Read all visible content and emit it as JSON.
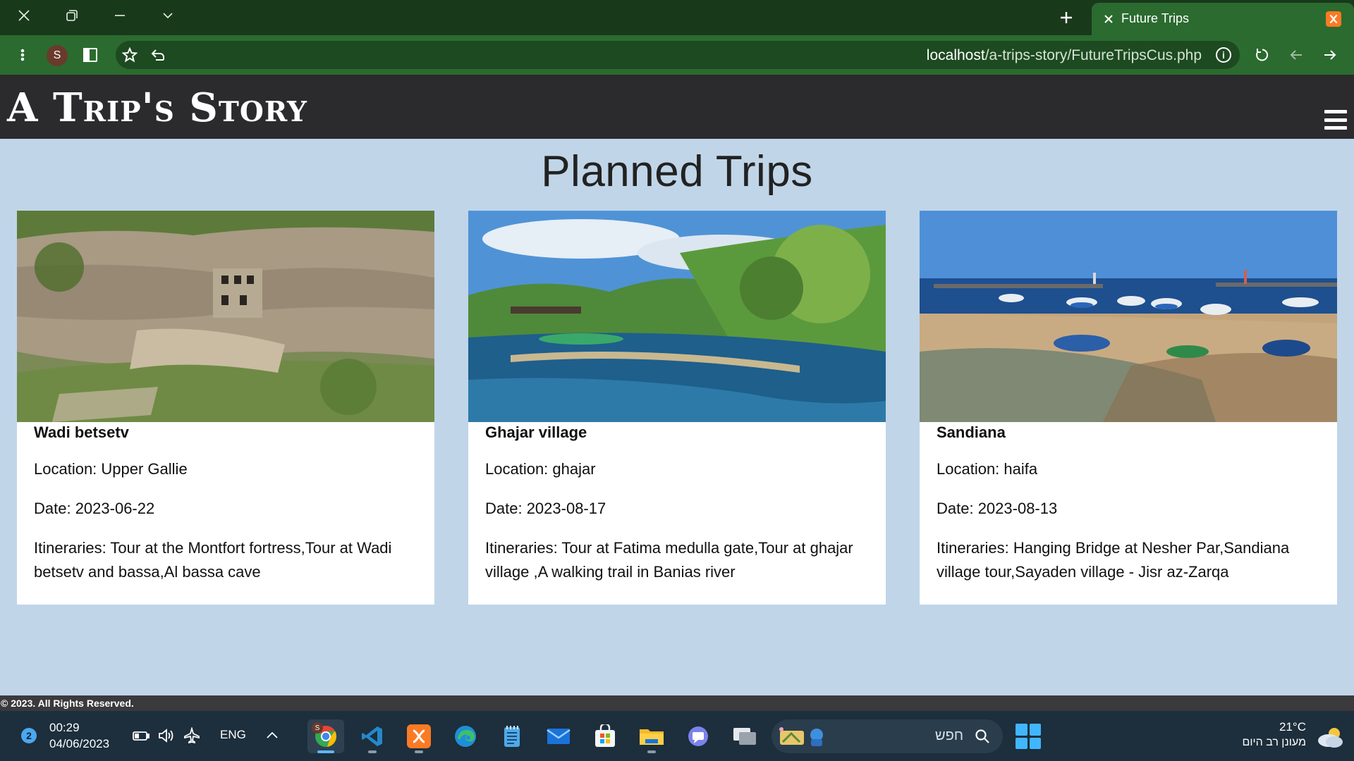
{
  "browser": {
    "tab_title": "Future Trips",
    "profile_initial": "S",
    "url_host": "localhost",
    "url_path": "/a-trips-story/FutureTripsCus.php",
    "site_info_glyph": "i"
  },
  "site": {
    "logo": "A Trip's Story",
    "menu_icon": "hamburger-menu-icon"
  },
  "main": {
    "title": "Planned Trips",
    "cards": [
      {
        "name": "Wadi betsetv",
        "location": "Location: Upper Gallie",
        "date": "Date: 2023-06-22",
        "itineraries": "Itineraries: Tour at the Montfort fortress,Tour at Wadi betsetv and bassa,Al bassa cave",
        "image": "cliff-with-rock-cut-tombs"
      },
      {
        "name": "Ghajar village",
        "location": "Location: ghajar",
        "date": "Date: 2023-08-17",
        "itineraries": "Itineraries: Tour at Fatima medulla gate,Tour at ghajar village ,A walking trail in Banias river",
        "image": "river-with-trees"
      },
      {
        "name": "Sandiana",
        "location": "Location: haifa",
        "date": "Date: 2023-08-13",
        "itineraries": "Itineraries: Hanging Bridge at Nesher Par,Sandiana village tour,Sayaden village - Jisr az-Zarqa",
        "image": "beach-with-fishing-boats"
      }
    ]
  },
  "footer": {
    "text": "© 2023. All Rights Reserved."
  },
  "taskbar": {
    "notification_count": "2",
    "time": "00:29",
    "date": "04/06/2023",
    "language": "ENG",
    "search_placeholder": "חפש",
    "temperature": "21°C",
    "weather_desc": "מעונן רב היום",
    "chrome_badge": "S"
  },
  "colors": {
    "browser_frame": "#19391b",
    "browser_toolbar": "#2b6b2f",
    "site_header": "#2b2a2d",
    "page_background": "#c0d5e8",
    "taskbar": "#1d2e3c"
  }
}
